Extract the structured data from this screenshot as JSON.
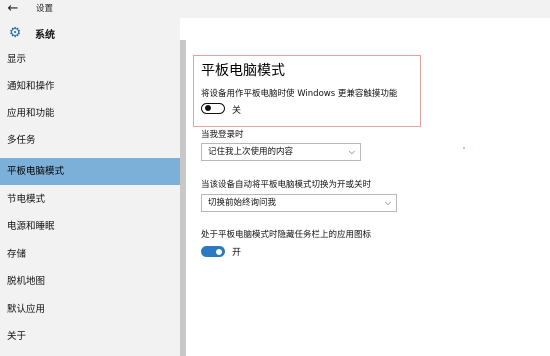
{
  "window": {
    "back_icon": "arrow-left-icon",
    "title": "设置"
  },
  "sidebar": {
    "header_icon": "gear-icon",
    "header_label": "系统",
    "items": [
      {
        "label": "显示"
      },
      {
        "label": "通知和操作"
      },
      {
        "label": "应用和功能"
      },
      {
        "label": "多任务"
      },
      {
        "label": "平板电脑模式",
        "selected": true
      },
      {
        "label": "节电模式"
      },
      {
        "label": "电源和睡眠"
      },
      {
        "label": "存储"
      },
      {
        "label": "脱机地图"
      },
      {
        "label": "默认应用"
      },
      {
        "label": "关于"
      }
    ]
  },
  "main": {
    "title": "平板电脑模式",
    "tablet_mode_description": "将设备用作平板电脑时使 Windows 更兼容触摸功能",
    "tablet_mode_toggle": {
      "state_label": "关",
      "on": false
    },
    "signin_label": "当我登录时",
    "signin_dropdown_value": "记住我上次使用的内容",
    "auto_switch_label": "当该设备自动将平板电脑模式切换为开或关时",
    "auto_switch_dropdown_value": "切换前始终询问我",
    "hide_icons_label": "处于平板电脑模式时隐藏任务栏上的应用图标",
    "hide_icons_toggle": {
      "state_label": "开",
      "on": true
    }
  },
  "colors": {
    "accent": "#2b7bc0",
    "selected_bg": "#7db0d8",
    "highlight_border": "#e8a0a0"
  }
}
